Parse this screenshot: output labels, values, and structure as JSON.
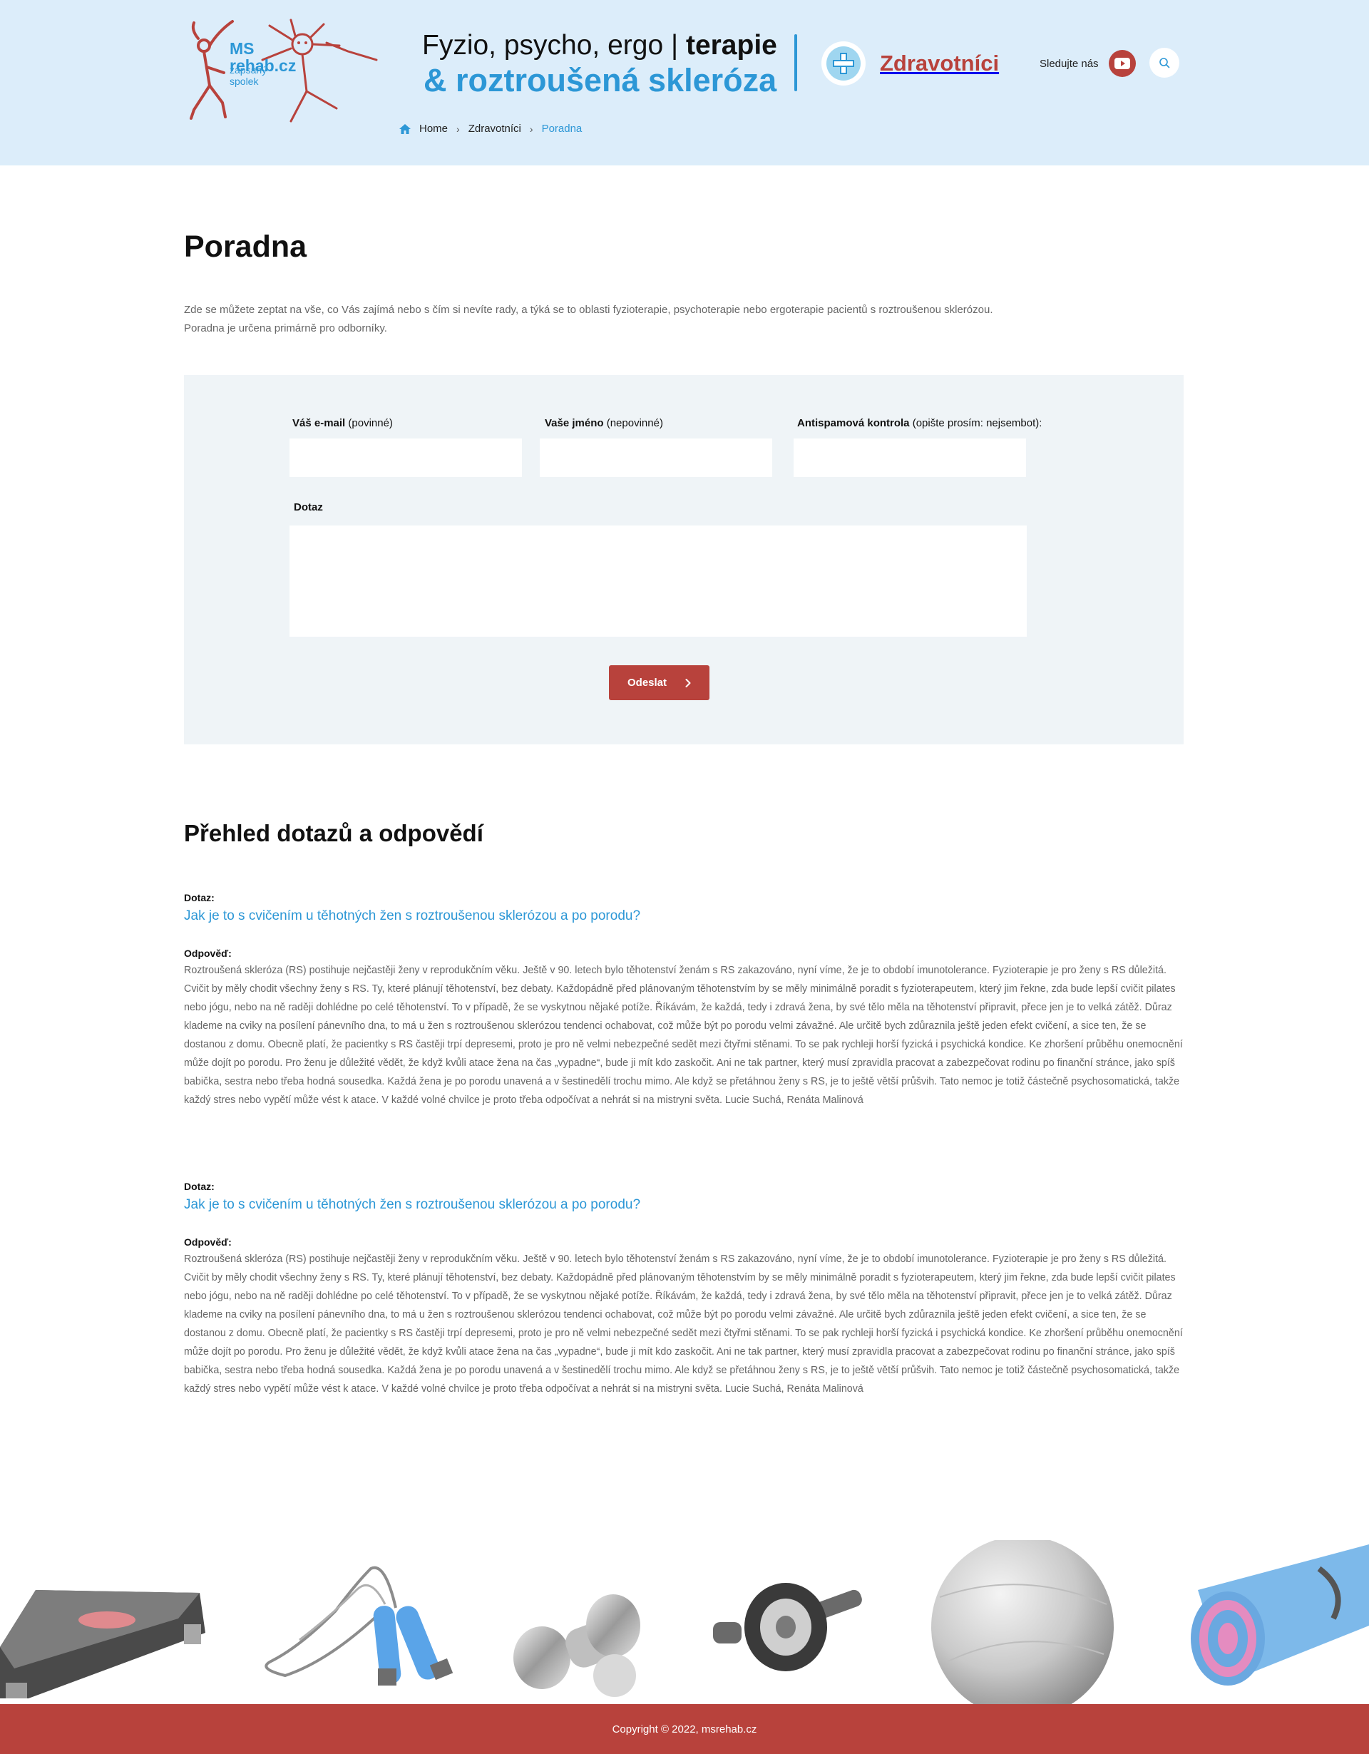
{
  "header": {
    "logo": {
      "line1": "MS",
      "line2": "rehab.cz",
      "sub1": "zapsaný",
      "sub2": "spolek"
    },
    "tagline_part1": "Fyzio, psycho, ergo | ",
    "tagline_bold": "terapie",
    "tagline_line2": "& roztroušená skleróza",
    "section_link": "Zdravotníci",
    "follow_label": "Sledujte nás",
    "icons": {
      "youtube": "youtube-icon",
      "search": "search-icon",
      "section": "plus-icon"
    }
  },
  "breadcrumb": {
    "items": [
      "Home",
      "Zdravotníci",
      "Poradna"
    ]
  },
  "page": {
    "title": "Poradna",
    "intro_line1": "Zde se můžete zeptat na vše, co Vás zajímá nebo s čím si nevíte rady, a týká se to oblasti fyzioterapie, psychoterapie nebo ergoterapie pacientů s roztroušenou sklerózou.",
    "intro_line2": "Poradna je určena primárně pro odborníky."
  },
  "form": {
    "email_label": "Váš e-mail",
    "email_note": " (povinné)",
    "email_value": "",
    "name_label": "Vaše jméno",
    "name_note": " (nepovinné)",
    "name_value": "",
    "antispam_label": "Antispamová kontrola",
    "antispam_note": " (opište prosím: nejsembot):",
    "antispam_value": "",
    "question_label": "Dotaz",
    "question_value": "",
    "submit_label": "Odeslat"
  },
  "qa_section": {
    "title": "Přehled dotazů a odpovědí",
    "question_label": "Dotaz:",
    "answer_label": "Odpověď:",
    "items": [
      {
        "question": "Jak je to s cvičením u těhotných žen s roztroušenou sklerózou a po porodu?",
        "answer": "Roztroušená skleróza (RS) postihuje nejčastěji ženy v reprodukčním věku. Ještě v 90. letech bylo těhotenství ženám s RS zakazováno, nyní víme, že je to období imunotolerance. Fyzioterapie je pro ženy s RS důležitá. Cvičit by měly chodit všechny ženy s RS. Ty, které plánují těhotenství, bez debaty. Každopádně před plánovaným těhotenstvím by se měly minimálně poradit s fyzioterapeutem, který jim řekne, zda bude lepší cvičit pilates nebo jógu, nebo na ně raději dohlédne po celé těhotenství. To v případě, že se vyskytnou nějaké potíže. Říkávám, že každá, tedy i zdravá žena, by své tělo měla na těhotenství připravit, přece jen je to velká zátěž. Důraz klademe na cviky na posílení pánevního dna, to má u žen s roztroušenou sklerózou tendenci ochabovat, což může být po porodu velmi závažné. Ale určitě bych zdůraznila ještě jeden efekt cvičení, a sice ten, že se dostanou z domu. Obecně platí, že pacientky s RS častěji trpí depresemi, proto je pro ně velmi nebezpečné sedět mezi čtyřmi stěnami. To se pak rychleji horší fyzická i psychická kondice. Ke zhoršení průběhu onemocnění může dojít po porodu. Pro ženu je důležité vědět, že když kvůli atace žena na čas „vypadne“, bude ji mít kdo zaskočit. Ani ne tak partner, který musí zpravidla pracovat a zabezpečovat rodinu po finanční stránce, jako spíš babička, sestra nebo třeba hodná sousedka. Každá žena je po porodu unavená a v šestinedělí trochu mimo. Ale když se přetáhnou ženy s RS, je to ještě větší průšvih. Tato nemoc je totiž částečně psychosomatická, takže každý stres nebo vypětí může vést k atace. V každé volné chvilce je proto třeba odpočívat a nehrát si na mistryni světa. Lucie Suchá, Renáta Malinová"
      },
      {
        "question": "Jak je to s cvičením u těhotných žen s roztroušenou sklerózou a po porodu?",
        "answer": "Roztroušená skleróza (RS) postihuje nejčastěji ženy v reprodukčním věku. Ještě v 90. letech bylo těhotenství ženám s RS zakazováno, nyní víme, že je to období imunotolerance. Fyzioterapie je pro ženy s RS důležitá. Cvičit by měly chodit všechny ženy s RS. Ty, které plánují těhotenství, bez debaty. Každopádně před plánovaným těhotenstvím by se měly minimálně poradit s fyzioterapeutem, který jim řekne, zda bude lepší cvičit pilates nebo jógu, nebo na ně raději dohlédne po celé těhotenství. To v případě, že se vyskytnou nějaké potíže. Říkávám, že každá, tedy i zdravá žena, by své tělo měla na těhotenství připravit, přece jen je to velká zátěž. Důraz klademe na cviky na posílení pánevního dna, to má u žen s roztroušenou sklerózou tendenci ochabovat, což může být po porodu velmi závažné. Ale určitě bych zdůraznila ještě jeden efekt cvičení, a sice ten, že se dostanou z domu. Obecně platí, že pacientky s RS častěji trpí depresemi, proto je pro ně velmi nebezpečné sedět mezi čtyřmi stěnami. To se pak rychleji horší fyzická i psychická kondice. Ke zhoršení průběhu onemocnění může dojít po porodu. Pro ženu je důležité vědět, že když kvůli atace žena na čas „vypadne“, bude ji mít kdo zaskočit. Ani ne tak partner, který musí zpravidla pracovat a zabezpečovat rodinu po finanční stránce, jako spíš babička, sestra nebo třeba hodná sousedka. Každá žena je po porodu unavená a v šestinedělí trochu mimo. Ale když se přetáhnou ženy s RS, je to ještě větší průšvih. Tato nemoc je totiž částečně psychosomatická, takže každý stres nebo vypětí může vést k atace. V každé volné chvilce je proto třeba odpočívat a nehrát si na mistryni světa. Lucie Suchá, Renáta Malinová"
      }
    ]
  },
  "equipment": [
    "step-platform",
    "jump-rope",
    "dumbbells",
    "ab-roller",
    "fitness-ball",
    "yoga-mat"
  ],
  "footer": {
    "copyright": "Copyright © 2022, msrehab.cz"
  },
  "colors": {
    "header_bg": "#dcedfa",
    "accent_blue": "#2c97d6",
    "accent_red": "#b8423c",
    "panel_bg": "#eff4f7"
  }
}
